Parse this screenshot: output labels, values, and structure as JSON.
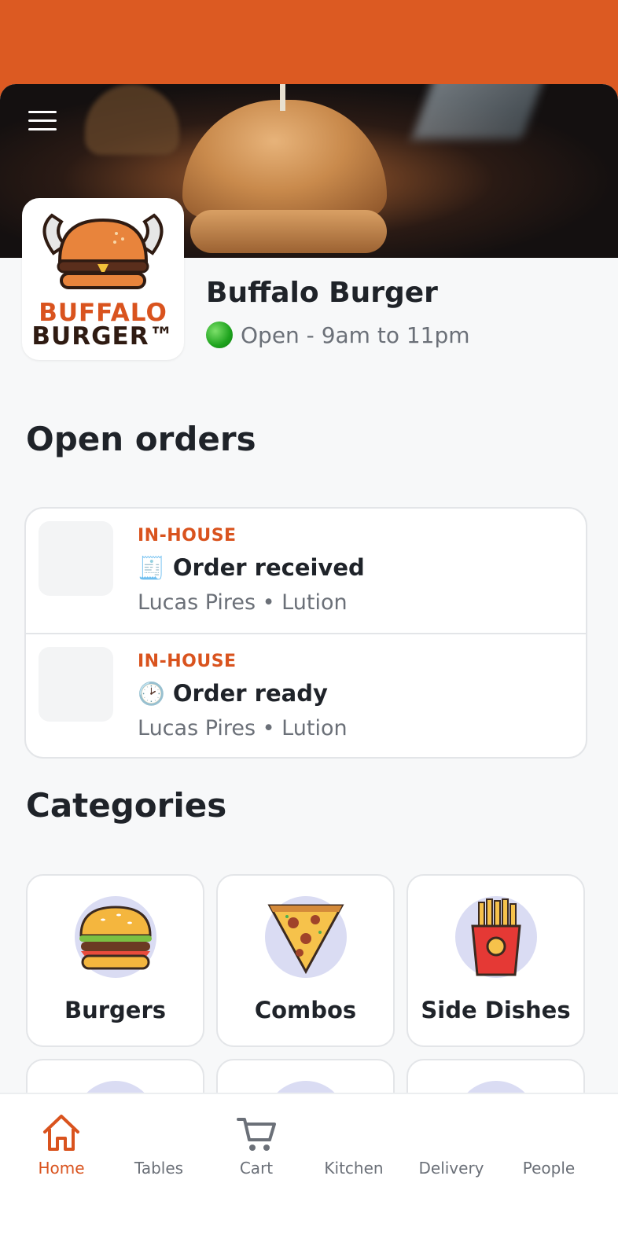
{
  "store": {
    "name": "Buffalo Burger",
    "status": "Open - 9am to 11pm",
    "logo_line1": "BUFFALO",
    "logo_line2": "BURGER™"
  },
  "sections": {
    "open_orders": "Open orders",
    "categories": "Categories"
  },
  "orders": [
    {
      "type": "IN-HOUSE",
      "status_emoji": "🧾",
      "status": "Order received",
      "meta": "Lucas Pires • Lution"
    },
    {
      "type": "IN-HOUSE",
      "status_emoji": "🕑",
      "status": "Order ready",
      "meta": "Lucas Pires • Lution"
    }
  ],
  "categories": [
    {
      "label": "Burgers",
      "icon": "burger-icon"
    },
    {
      "label": "Combos",
      "icon": "pizza-icon"
    },
    {
      "label": "Side Dishes",
      "icon": "fries-icon"
    }
  ],
  "nav": {
    "home": "Home",
    "tables": "Tables",
    "cart": "Cart",
    "kitchen": "Kitchen",
    "delivery": "Delivery",
    "people": "People"
  },
  "colors": {
    "accent": "#dc5a22",
    "background": "#f7f8f9",
    "category_circle": "#dadcf3"
  }
}
